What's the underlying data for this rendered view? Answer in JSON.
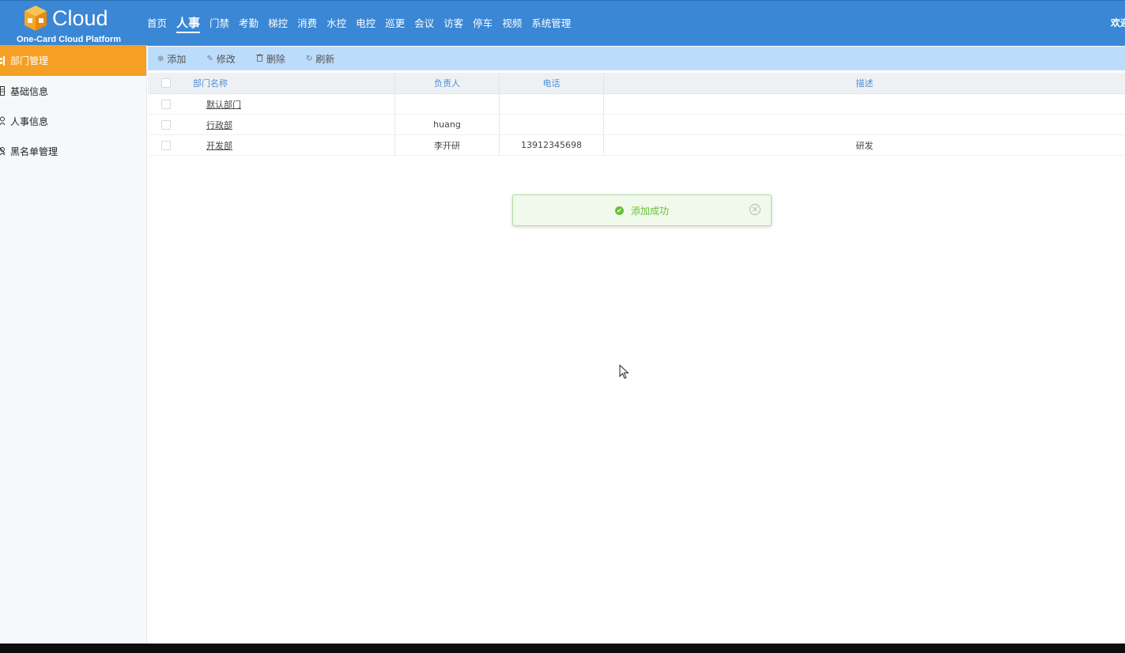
{
  "brand": {
    "name": "Cloud",
    "subtitle": "One-Card Cloud Platform"
  },
  "nav": {
    "items": [
      {
        "label": "首页",
        "active": false
      },
      {
        "label": "人事",
        "active": true
      },
      {
        "label": "门禁",
        "active": false
      },
      {
        "label": "考勤",
        "active": false
      },
      {
        "label": "梯控",
        "active": false
      },
      {
        "label": "消费",
        "active": false
      },
      {
        "label": "水控",
        "active": false
      },
      {
        "label": "电控",
        "active": false
      },
      {
        "label": "巡更",
        "active": false
      },
      {
        "label": "会议",
        "active": false
      },
      {
        "label": "访客",
        "active": false
      },
      {
        "label": "停车",
        "active": false
      },
      {
        "label": "视频",
        "active": false
      },
      {
        "label": "系统管理",
        "active": false
      }
    ],
    "welcome": "欢迎"
  },
  "sidebar": {
    "items": [
      {
        "label": "部门管理",
        "icon": "org-chart-icon",
        "active": true
      },
      {
        "label": "基础信息",
        "icon": "document-icon",
        "active": false
      },
      {
        "label": "人事信息",
        "icon": "user-icon",
        "active": false
      },
      {
        "label": "黑名单管理",
        "icon": "block-user-icon",
        "active": false
      }
    ]
  },
  "toolbar": {
    "add": "添加",
    "edit": "修改",
    "delete": "删除",
    "refresh": "刷新"
  },
  "table": {
    "columns": {
      "name": "部门名称",
      "owner": "负责人",
      "phone": "电话",
      "desc": "描述"
    },
    "rows": [
      {
        "name": "默认部门",
        "owner": "",
        "phone": "",
        "desc": ""
      },
      {
        "name": "行政部",
        "owner": "huang",
        "phone": "",
        "desc": ""
      },
      {
        "name": "开发部",
        "owner": "李开研",
        "phone": "13912345698",
        "desc": "研发"
      }
    ]
  },
  "toast": {
    "message": "添加成功",
    "type": "success",
    "color": "#67c23a"
  },
  "colors": {
    "header": "#3a87d5",
    "sidebar_active": "#f5a024",
    "toolbar": "#bcdcfb",
    "column_header_text": "#4c8fd6"
  }
}
